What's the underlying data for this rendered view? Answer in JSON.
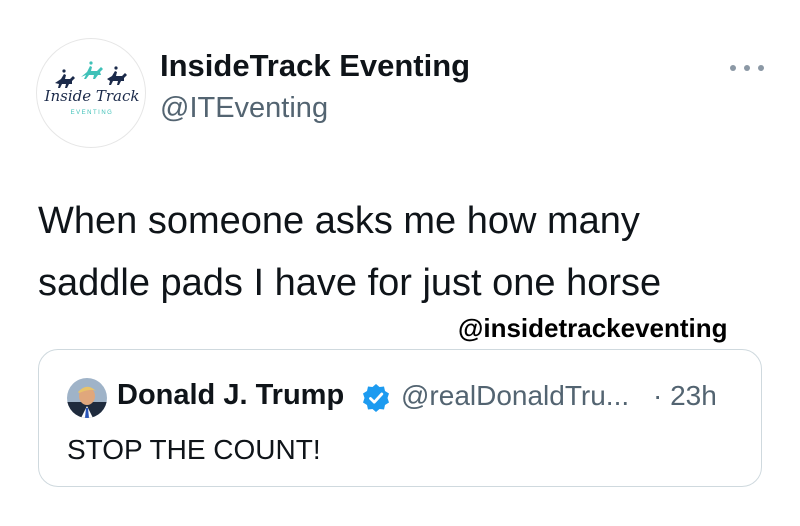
{
  "tweet": {
    "display_name": "InsideTrack Eventing",
    "handle": "@ITEventing",
    "text": "When someone asks me how many saddle pads I have for just one horse",
    "watermark": "@insidetrackeventing",
    "avatar_logo": {
      "script_text": "Inside Track",
      "subtext": "EVENTING",
      "colors": {
        "navy": "#1b2a4a",
        "teal": "#3fc1b8"
      }
    },
    "more_icon": "more-horizontal-icon"
  },
  "quoted_tweet": {
    "display_name": "Donald J. Trump",
    "verified_icon": "verified-badge-icon",
    "verified_color": "#1d9bf0",
    "handle": "@realDonaldTru...",
    "timestamp": "· 23h",
    "text": "STOP THE COUNT!"
  }
}
